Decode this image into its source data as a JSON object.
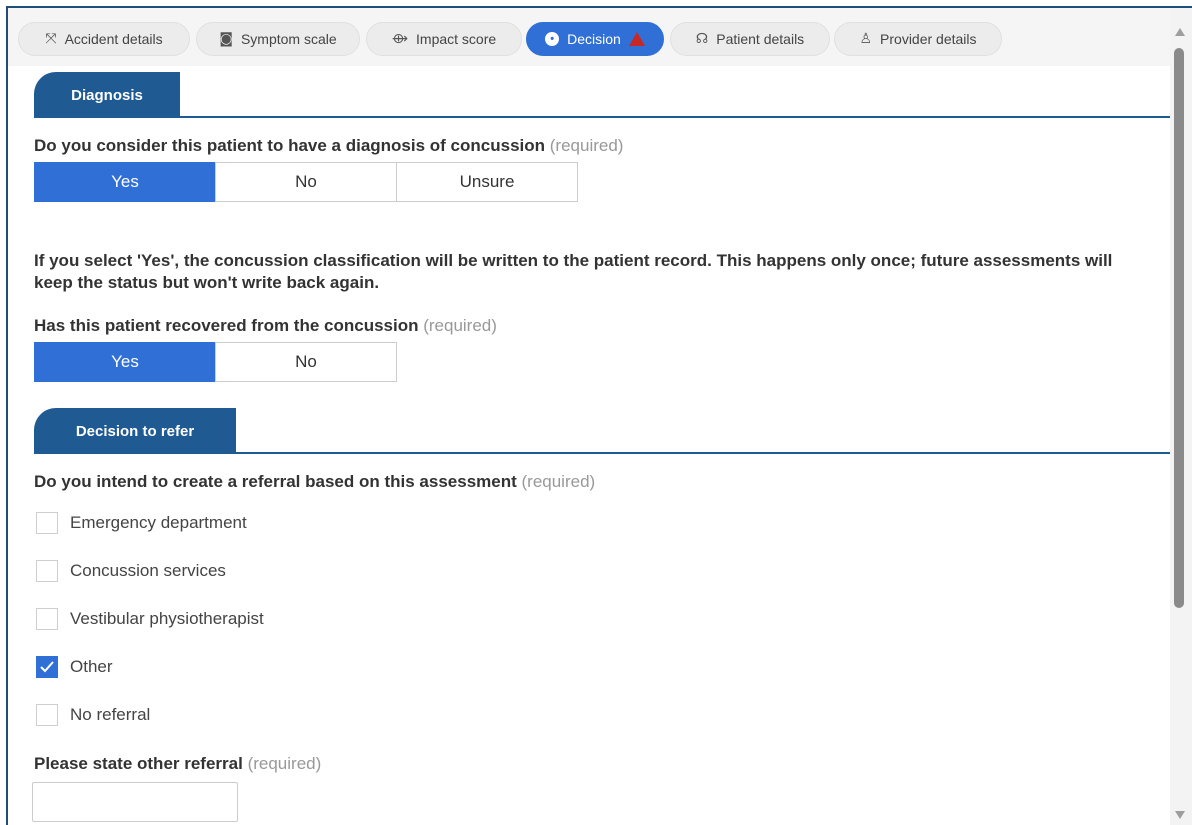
{
  "tabs": [
    {
      "label": "Accident details",
      "icon": "accident-icon",
      "glyph": "⤧"
    },
    {
      "label": "Symptom scale",
      "icon": "symptom-icon",
      "glyph": "◙"
    },
    {
      "label": "Impact score",
      "icon": "impact-icon",
      "glyph": "⟴"
    },
    {
      "label": "Decision",
      "icon": "decision-icon",
      "glyph": "●",
      "active": true,
      "warning": true
    },
    {
      "label": "Patient details",
      "icon": "patient-icon",
      "glyph": "☊"
    },
    {
      "label": "Provider details",
      "icon": "provider-icon",
      "glyph": "♙"
    }
  ],
  "diagnosis": {
    "section_title": "Diagnosis",
    "q1": {
      "text": "Do you consider this patient to have a diagnosis of concussion",
      "required": "(required)",
      "options": [
        "Yes",
        "No",
        "Unsure"
      ],
      "selected": "Yes"
    },
    "info": "If you select 'Yes', the concussion classification will be written to the patient record. This happens only once; future assessments will keep the status but won't write back again.",
    "q2": {
      "text": "Has this patient recovered from the concussion",
      "required": "(required)",
      "options": [
        "Yes",
        "No"
      ],
      "selected": "Yes"
    }
  },
  "refer": {
    "section_title": "Decision to refer",
    "q": {
      "text": "Do you intend to create a referral based on this assessment",
      "required": "(required)"
    },
    "options": [
      {
        "label": "Emergency department",
        "checked": false
      },
      {
        "label": "Concussion services",
        "checked": false
      },
      {
        "label": "Vestibular physiotherapist",
        "checked": false
      },
      {
        "label": "Other",
        "checked": true
      },
      {
        "label": "No referral",
        "checked": false
      }
    ],
    "other": {
      "text": "Please state other referral",
      "required": "(required)",
      "value": ""
    }
  },
  "colors": {
    "accent": "#2f6fd6",
    "section": "#1f5a93",
    "warning": "#c62828"
  }
}
